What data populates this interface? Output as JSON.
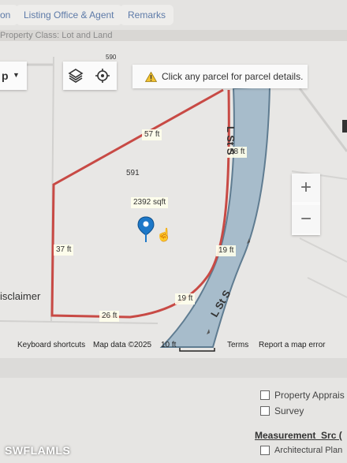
{
  "tabs": [
    {
      "label": "on"
    },
    {
      "label": "Listing Office & Agent"
    },
    {
      "label": "Remarks"
    }
  ],
  "property_class": "Property Class: Lot and Land",
  "map": {
    "layer_dropdown_label": "p",
    "notice_text": "Click any parcel for parcel details.",
    "parcel_number_top": "590",
    "parcel_number": "591",
    "area_label": "2392 sqft",
    "dimensions": {
      "top": "57 ft",
      "upper_right": "38 ft",
      "left": "37 ft",
      "right": "19 ft",
      "bottom_right": "19 ft",
      "bottom": "26 ft"
    },
    "street_upper": "L St S",
    "street_lower": "L St S",
    "zoom_in": "+",
    "zoom_out": "−",
    "disclaimer": "isclaimer",
    "footer": {
      "shortcuts": "Keyboard shortcuts",
      "map_data": "Map data ©2025",
      "scale": "10 ft",
      "terms": "Terms",
      "report": "Report a map error"
    },
    "colors": {
      "parcel_line": "#c84a45",
      "road": "#a7bccb",
      "road_edge": "#5f7c91"
    }
  },
  "checkboxes": [
    {
      "label": "Property Apprais"
    },
    {
      "label": "Survey"
    }
  ],
  "measurement_heading": "Measurement_Src (",
  "architectural": "Architectural Plan",
  "watermark": "SWFLAMLS"
}
